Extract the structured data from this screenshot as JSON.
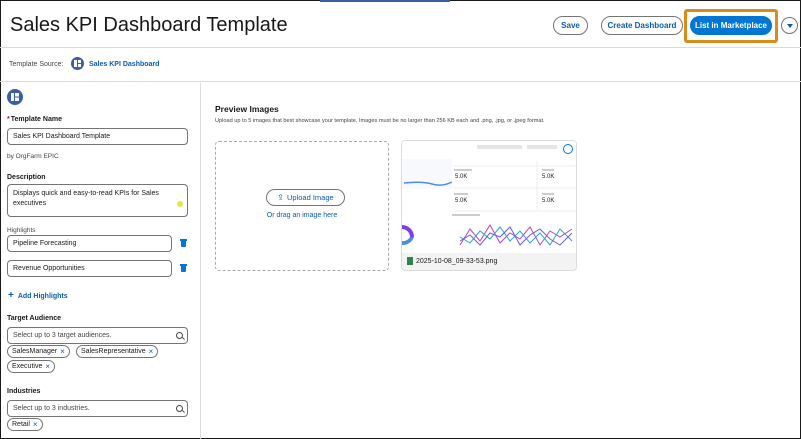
{
  "header": {
    "title": "Sales KPI Dashboard Template",
    "save_label": "Save",
    "create_label": "Create Dashboard",
    "list_label": "List in Marketplace"
  },
  "source": {
    "label": "Template Source:",
    "link": "Sales KPI Dashboard"
  },
  "form": {
    "template_name_label": "Template Name",
    "template_name_value": "Sales KPI Dashboard Template",
    "by_line": "by OrgFarm EPIC",
    "description_label": "Description",
    "description_value": "Displays quick and easy-to-read KPIs for Sales executives",
    "highlights_label": "Highlights",
    "highlights": [
      "Pipeline Forecasting",
      "Revenue Opportunities"
    ],
    "add_highlights": "Add Highlights",
    "audience_label": "Target Audience",
    "audience_placeholder": "Select up to 3 target audiences.",
    "audience_pills": [
      "SalesManager",
      "SalesRepresentative",
      "Executive"
    ],
    "industries_label": "Industries",
    "industries_placeholder": "Select up to 3 industries.",
    "industry_pills": [
      "Retail"
    ]
  },
  "preview": {
    "title": "Preview Images",
    "description": "Upload up to 5 images that best showcase your template. Images must be no larger than 256 KB each and .png, .jpg, or .jpeg format.",
    "upload_label": "Upload Image",
    "drag_text": "Or drag an image here",
    "thumb_filename": "2025-10-08_09-33-53.png",
    "thumb_metrics": [
      "5.0K",
      "5.0K",
      "5.0K",
      "5.0K"
    ]
  },
  "colors": {
    "brand": "#0176d3",
    "highlight": "#d98b1c",
    "link": "#0b5cab"
  }
}
